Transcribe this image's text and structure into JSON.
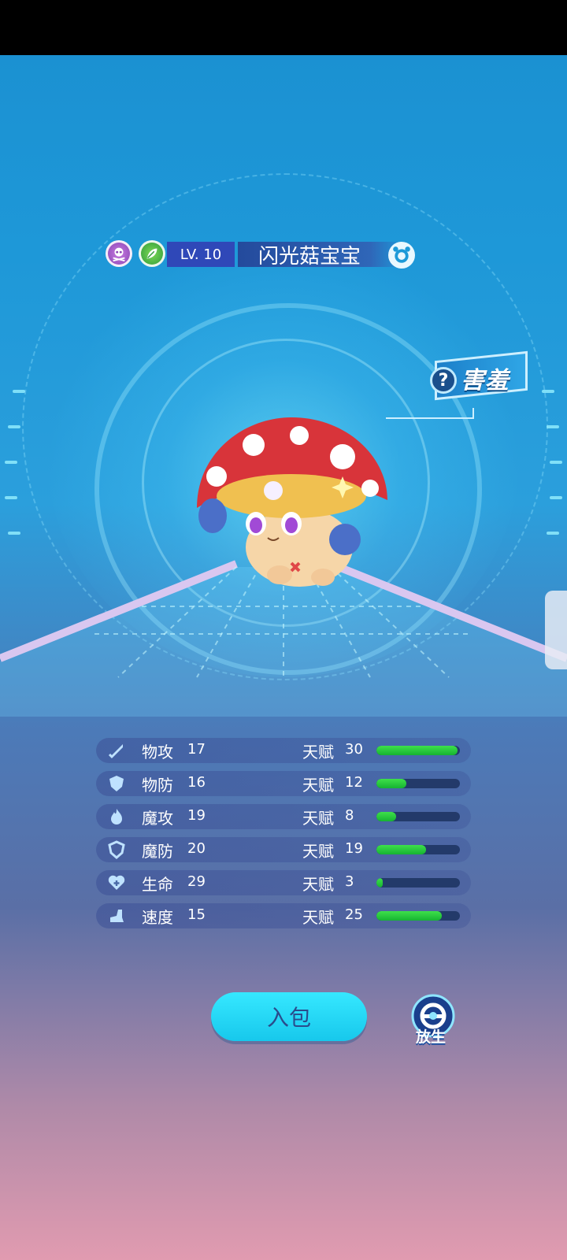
{
  "header": {
    "element_badges": [
      "poison-icon",
      "grass-icon"
    ],
    "level": "LV. 10",
    "pet_name": "闪光菇宝宝",
    "gender_icon": "gender-icon"
  },
  "trait": {
    "help_icon": "?",
    "label": "害羞"
  },
  "stats": [
    {
      "icon": "sword-icon",
      "name": "物攻",
      "value": "17",
      "talent_label": "天赋",
      "talent": "30",
      "talent_fraction": 0.97
    },
    {
      "icon": "shield-icon",
      "name": "物防",
      "value": "16",
      "talent_label": "天赋",
      "talent": "12",
      "talent_fraction": 0.36
    },
    {
      "icon": "flame-icon",
      "name": "魔攻",
      "value": "19",
      "talent_label": "天赋",
      "talent": "8",
      "talent_fraction": 0.24
    },
    {
      "icon": "magic-shield-icon",
      "name": "魔防",
      "value": "20",
      "talent_label": "天赋",
      "talent": "19",
      "talent_fraction": 0.59
    },
    {
      "icon": "heart-icon",
      "name": "生命",
      "value": "29",
      "talent_label": "天赋",
      "talent": "3",
      "talent_fraction": 0.08
    },
    {
      "icon": "boot-icon",
      "name": "速度",
      "value": "15",
      "talent_label": "天赋",
      "talent": "25",
      "talent_fraction": 0.78
    }
  ],
  "actions": {
    "bag_label": "入包",
    "release_label": "放生"
  },
  "colors": {
    "talent_bar": "#22c93a",
    "bag_button": "#2ad8f6",
    "level_bg": "#2f48b8"
  }
}
